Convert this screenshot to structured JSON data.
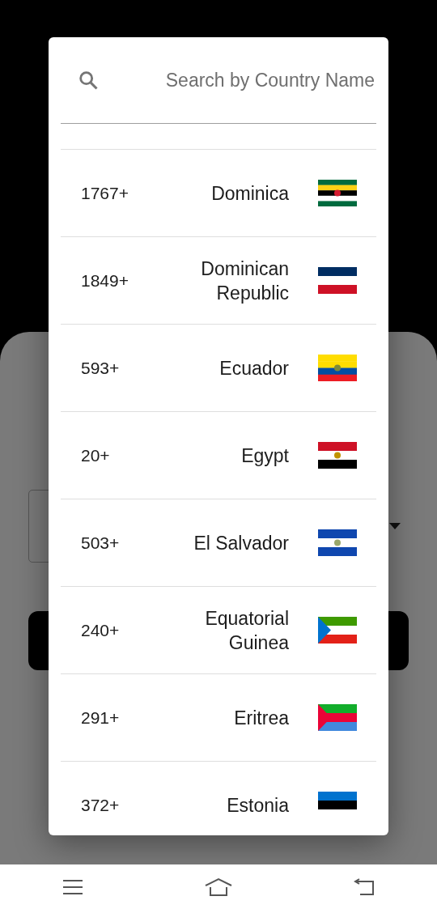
{
  "search": {
    "placeholder": "Search by Country Name"
  },
  "countries": [
    {
      "code": "1767+",
      "name": "Dominica"
    },
    {
      "code": "1849+",
      "name": "Dominican Republic"
    },
    {
      "code": "593+",
      "name": "Ecuador"
    },
    {
      "code": "20+",
      "name": "Egypt"
    },
    {
      "code": "503+",
      "name": "El Salvador"
    },
    {
      "code": "240+",
      "name": "Equatorial Guinea"
    },
    {
      "code": "291+",
      "name": "Eritrea"
    },
    {
      "code": "372+",
      "name": "Estonia"
    }
  ]
}
